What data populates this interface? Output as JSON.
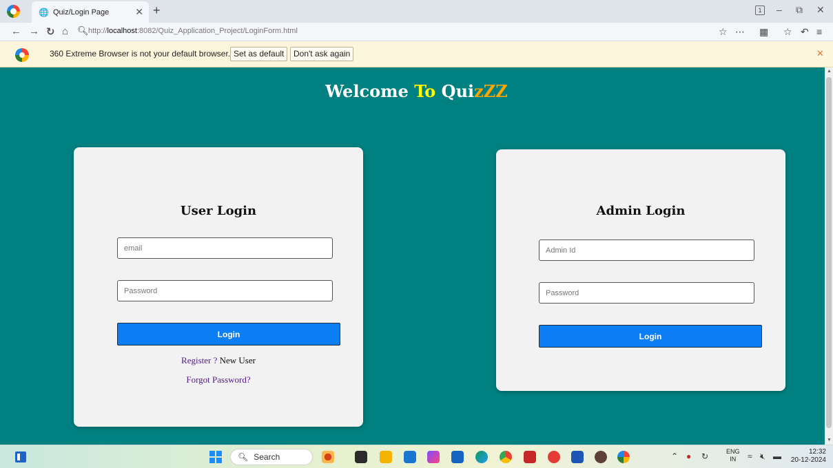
{
  "browser": {
    "tab_title": "Quiz/Login Page",
    "new_tab_glyph": "+",
    "tab_count": "1",
    "url_prefix": "http://",
    "url_host": "localhost",
    "url_rest": ":8082/Quiz_Application_Project/LoginForm.html"
  },
  "infobar": {
    "message": "360 Extreme Browser is not your default browser.",
    "set_default_label": "Set as default",
    "dont_ask_label": "Don't ask again"
  },
  "page": {
    "welcome_prefix": "Welcome ",
    "welcome_to": "To",
    "welcome_qui": " Qui",
    "welcome_zz": "zZZ",
    "colors": {
      "background": "#008080",
      "accent_yellow": "#ffff00",
      "accent_orange": "#ffa500",
      "button": "#0d7ff5"
    }
  },
  "user_login": {
    "title": "User Login",
    "email_placeholder": "email",
    "password_placeholder": "Password",
    "login_label": "Login",
    "register_link": "Register ?",
    "register_suffix": " New User",
    "forgot_link": "Forgot Password?"
  },
  "admin_login": {
    "title": "Admin Login",
    "id_placeholder": "Admin Id",
    "password_placeholder": "Password",
    "login_label": "Login"
  },
  "taskbar": {
    "search_label": "Search",
    "lang_top": "ENG",
    "lang_bottom": "IN",
    "time": "12:32",
    "date": "20-12-2024"
  }
}
